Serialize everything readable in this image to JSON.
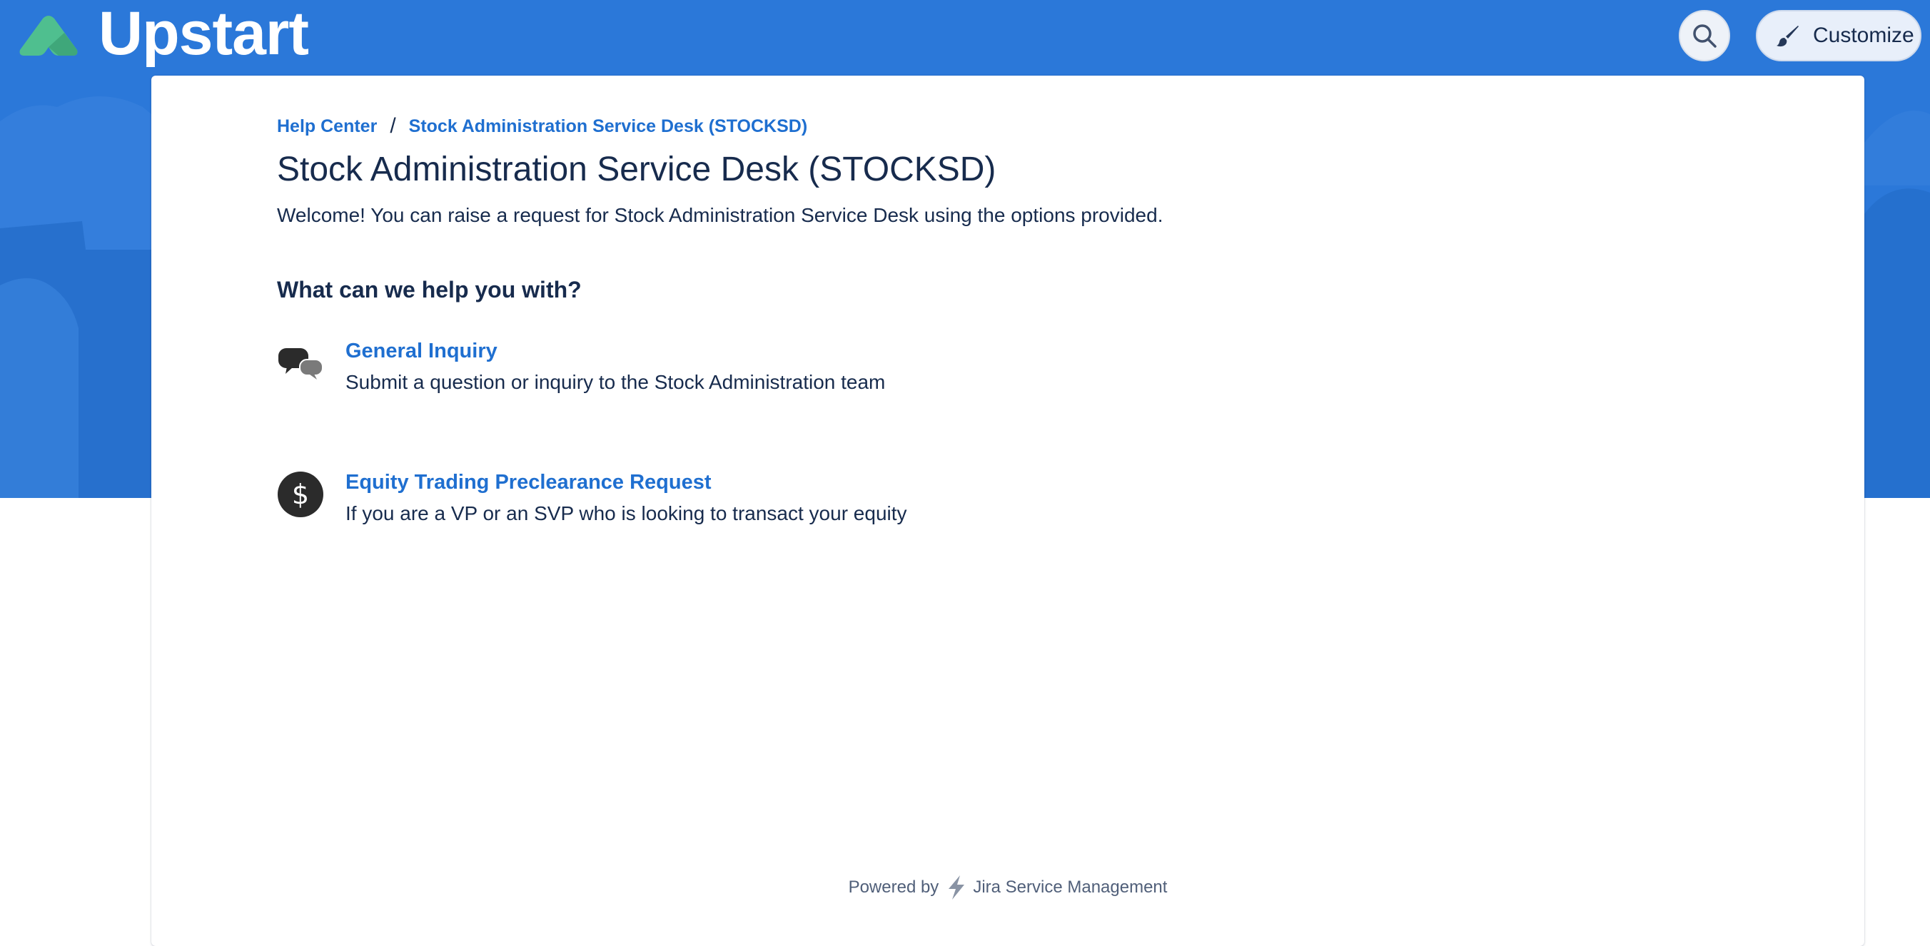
{
  "header": {
    "logo_text": "Upstart",
    "search_icon": "search-icon",
    "customize_label": "Customize",
    "customize_icon": "paintbrush-icon"
  },
  "colors": {
    "banner": "#2b78d9",
    "link": "#1f6fd0",
    "text": "#172b4d",
    "logo_mark": "#4fbf8f"
  },
  "breadcrumb": {
    "items": [
      "Help Center",
      "Stock Administration Service Desk (STOCKSD)"
    ],
    "separator": "/"
  },
  "portal": {
    "title": "Stock Administration Service Desk (STOCKSD)",
    "welcome": "Welcome! You can raise a request for Stock Administration Service Desk using the options provided.",
    "section_heading": "What can we help you with?"
  },
  "request_types": [
    {
      "title": "General Inquiry",
      "description": "Submit a question or inquiry to the Stock Administration team",
      "icon": "speech-bubbles-icon"
    },
    {
      "title": "Equity Trading Preclearance Request",
      "description": "If you are a VP or an SVP who is looking to transact your equity",
      "icon": "dollar-icon"
    }
  ],
  "footer": {
    "powered_by": "Powered by",
    "product": "Jira Service Management",
    "icon": "lightning-icon"
  }
}
